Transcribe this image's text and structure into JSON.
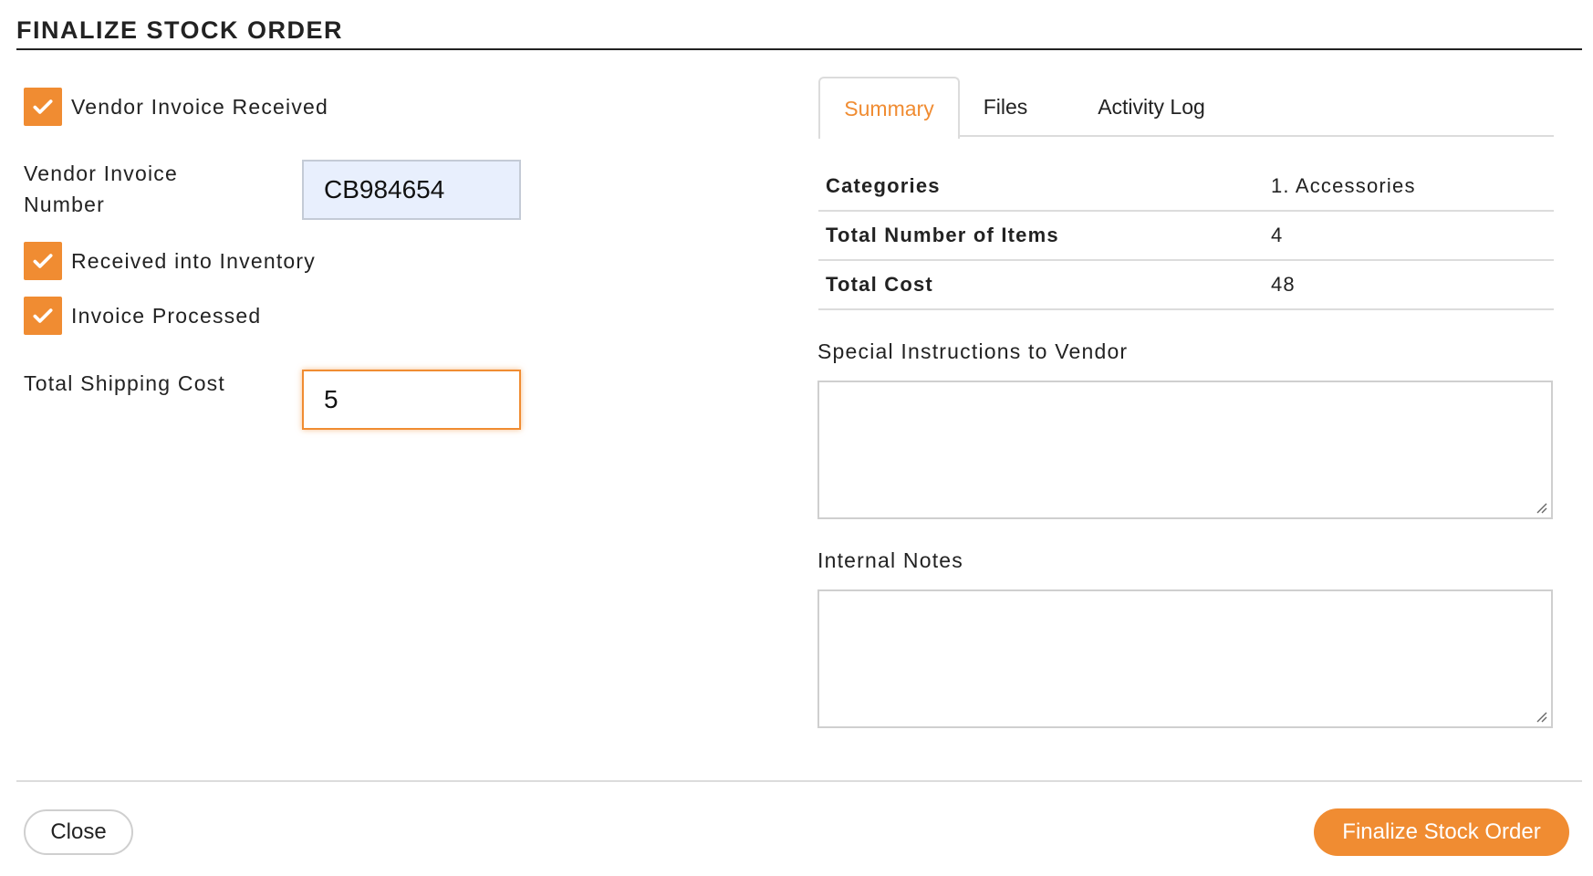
{
  "dialog": {
    "title": "FINALIZE STOCK ORDER"
  },
  "left": {
    "vendor_invoice_received": {
      "label": "Vendor Invoice Received",
      "checked": true
    },
    "vendor_invoice_number": {
      "label_line1": "Vendor Invoice",
      "label_line2": "Number",
      "value": "CB984654"
    },
    "received_into_inventory": {
      "label": "Received into Inventory",
      "checked": true
    },
    "invoice_processed": {
      "label": "Invoice Processed",
      "checked": true
    },
    "total_shipping_cost": {
      "label": "Total Shipping Cost",
      "value": "5"
    }
  },
  "tabs": [
    {
      "label": "Summary",
      "active": true
    },
    {
      "label": "Files",
      "active": false
    },
    {
      "label": "Activity Log",
      "active": false
    }
  ],
  "summary": {
    "rows": [
      {
        "key": "Categories",
        "value": "1. Accessories"
      },
      {
        "key": "Total Number of Items",
        "value": "4"
      },
      {
        "key": "Total Cost",
        "value": "48"
      }
    ]
  },
  "special_instructions": {
    "label": "Special Instructions to Vendor",
    "value": ""
  },
  "internal_notes": {
    "label": "Internal Notes",
    "value": ""
  },
  "footer": {
    "close_label": "Close",
    "finalize_label": "Finalize Stock Order"
  },
  "colors": {
    "accent": "#f08c32",
    "input_highlight": "#e8effd",
    "text": "#222222"
  }
}
